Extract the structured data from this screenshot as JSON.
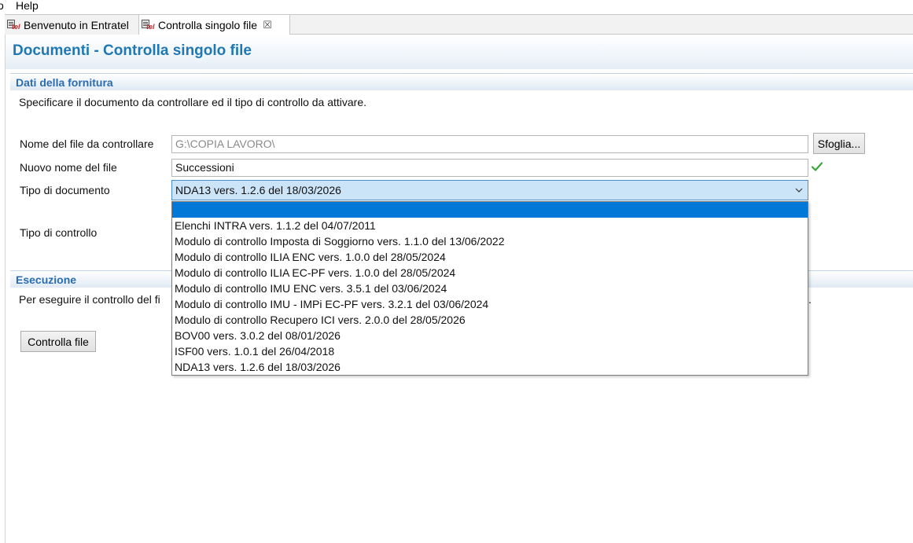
{
  "menu": {
    "items": [
      "o",
      "Help"
    ]
  },
  "tabs": [
    {
      "label": "Benvenuto in Entratel",
      "icon": "entratel-tel-icon",
      "icon_text": "tel",
      "active": false
    },
    {
      "label": "Controlla singolo file",
      "icon": "entratel-tel-icon",
      "icon_text": "tel",
      "active": true,
      "close": "☒"
    }
  ],
  "page": {
    "title": "Documenti - Controlla singolo file"
  },
  "fornitura": {
    "header": "Dati della fornitura",
    "instructions": "Specificare il documento da controllare ed il tipo di controllo da attivare.",
    "file_label": "Nome del file da controllare",
    "file_value": "G:\\COPIA LAVORO\\",
    "browse_label": "Sfoglia...",
    "newname_label": "Nuovo nome del file",
    "newname_value": "Successioni",
    "doctype_label": "Tipo di documento",
    "doctype_value": "NDA13 vers. 1.2.6 del 18/03/2026",
    "controltype_label": "Tipo di controllo"
  },
  "dropdown": {
    "options": [
      "",
      "Elenchi INTRA vers. 1.1.2 del 04/07/2011",
      "Modulo di controllo Imposta di Soggiorno vers. 1.1.0 del 13/06/2022",
      "Modulo di controllo ILIA ENC vers. 1.0.0 del 28/05/2024",
      "Modulo di controllo ILIA EC-PF vers. 1.0.0 del 28/05/2024",
      "Modulo di controllo IMU ENC vers. 3.5.1 del 03/06/2024",
      "Modulo di controllo IMU - IMPi EC-PF vers. 3.2.1 del 03/06/2024",
      "Modulo di controllo Recupero ICI vers. 2.0.0 del 28/05/2026",
      "BOV00 vers. 3.0.2 del 08/01/2026",
      "ISF00 vers. 1.0.1 del 26/04/2018",
      "NDA13 vers. 1.2.6 del 18/03/2026"
    ],
    "selected_index": 0
  },
  "esecuzione": {
    "header": "Esecuzione",
    "text_left": "Per eseguire il controllo del fi",
    "text_right": ".",
    "run_label": "Controlla file"
  },
  "colors": {
    "accent": "#1f77b4",
    "selection": "#0078d7",
    "combo_bg": "#cce4f7",
    "check": "#3aa63a"
  }
}
